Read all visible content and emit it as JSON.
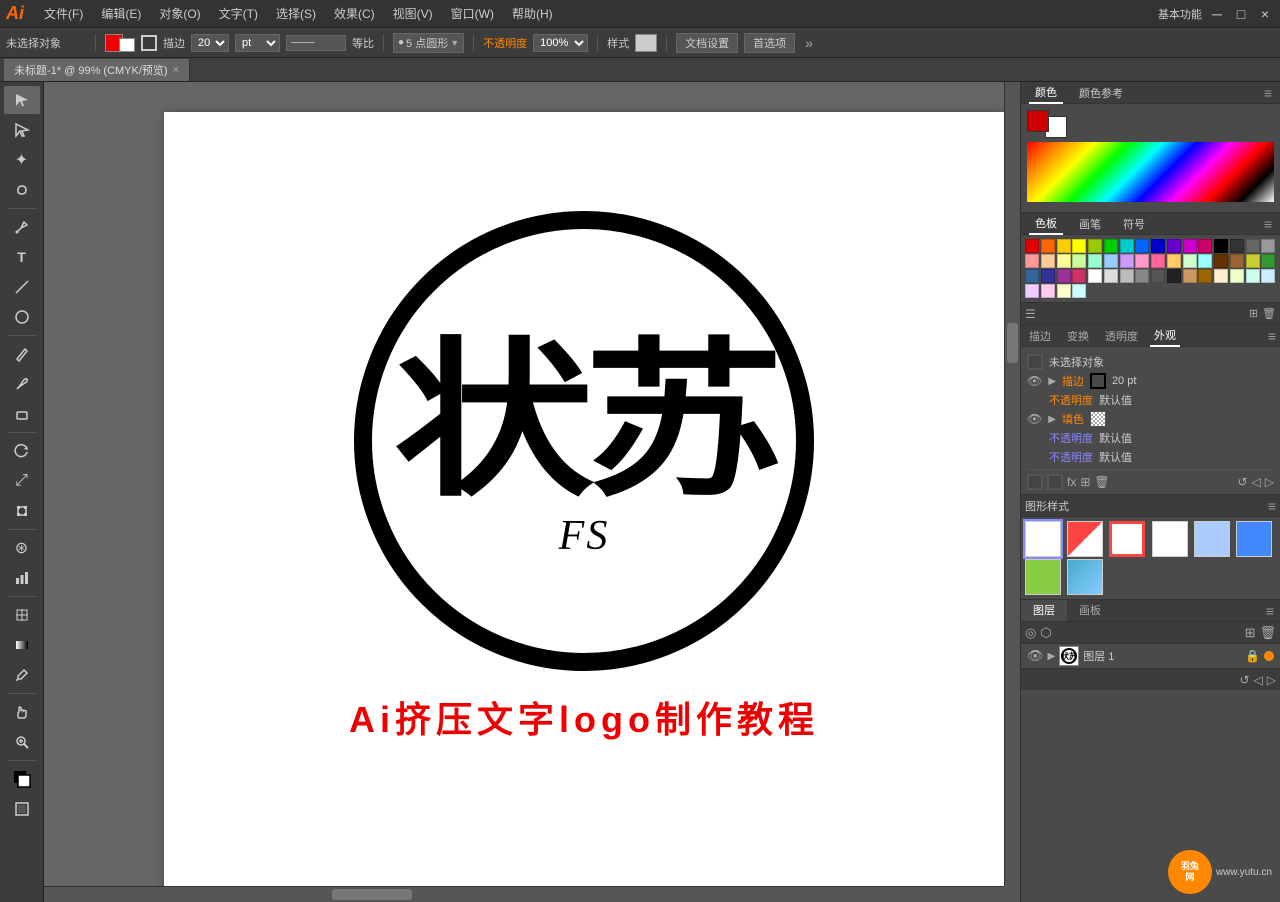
{
  "app": {
    "logo": "Ai",
    "title": "未标题-1",
    "workspace": "基本功能"
  },
  "menu": {
    "items": [
      "文件(F)",
      "编辑(E)",
      "对象(O)",
      "文字(T)",
      "选择(S)",
      "效果(C)",
      "视图(V)",
      "窗口(W)",
      "帮助(H)"
    ]
  },
  "options_bar": {
    "no_selection": "未选择对象",
    "stroke_label": "描边",
    "stroke_width": "20",
    "stroke_unit": "pt",
    "ratio_label": "等比",
    "points_label": "5 点圆形",
    "opacity_label": "不透明度",
    "opacity_value": "100%",
    "style_label": "样式",
    "doc_settings": "文档设置",
    "preferences": "首选项"
  },
  "tab": {
    "label": "未标题-1* @ 99% (CMYK/预览)",
    "close": "×"
  },
  "tools": [
    {
      "name": "selection-tool",
      "icon": "↖",
      "active": true
    },
    {
      "name": "direct-selection-tool",
      "icon": "↗"
    },
    {
      "name": "magic-wand-tool",
      "icon": "✦"
    },
    {
      "name": "lasso-tool",
      "icon": "⌖"
    },
    {
      "name": "pen-tool",
      "icon": "✒"
    },
    {
      "name": "type-tool",
      "icon": "T"
    },
    {
      "name": "line-tool",
      "icon": "／"
    },
    {
      "name": "ellipse-tool",
      "icon": "○"
    },
    {
      "name": "pencil-tool",
      "icon": "✏"
    },
    {
      "name": "paintbrush-tool",
      "icon": "🖌"
    },
    {
      "name": "blob-brush-tool",
      "icon": "◉"
    },
    {
      "name": "eraser-tool",
      "icon": "◻"
    },
    {
      "name": "rotate-tool",
      "icon": "↻"
    },
    {
      "name": "scale-tool",
      "icon": "⤢"
    },
    {
      "name": "free-transform-tool",
      "icon": "⊞"
    },
    {
      "name": "symbol-sprayer-tool",
      "icon": "⊛"
    },
    {
      "name": "column-graph-tool",
      "icon": "▊"
    },
    {
      "name": "mesh-tool",
      "icon": "⊞"
    },
    {
      "name": "gradient-tool",
      "icon": "■"
    },
    {
      "name": "eyedropper-tool",
      "icon": "🔍"
    },
    {
      "name": "blend-tool",
      "icon": "⋈"
    },
    {
      "name": "hand-tool",
      "icon": "✋"
    },
    {
      "name": "zoom-tool",
      "icon": "🔍"
    },
    {
      "name": "fill-stroke",
      "icon": "◧"
    }
  ],
  "right_panel": {
    "color_tab": "颜色",
    "color_ref_tab": "颜色参考",
    "swatches_tab": "色板",
    "brushes_tab": "画笔",
    "symbols_tab": "符号",
    "stroke_tab": "描边",
    "transform_tab": "变换",
    "transparency_tab": "透明度",
    "appearance_tab": "外观"
  },
  "appearance": {
    "section_label": "未选择对象",
    "stroke_label": "描边",
    "stroke_width": "20 pt",
    "fill_label": "填色",
    "opacity_label": "不透明度",
    "opacity_value": "默认值",
    "opacity_label2": "不透明度",
    "opacity_value2": "默认值",
    "opacity_label3": "不透明度",
    "opacity_value3": "默认值"
  },
  "graphic_styles": {
    "panel_label": "图形样式"
  },
  "layers": {
    "tab_label": "图层",
    "panel_tab2": "画板",
    "layer_name": "图层 1"
  },
  "canvas": {
    "logo_chars": "状苏",
    "logo_sub": "FS",
    "tutorial_text": "Ai挤压文字logo制作教程"
  },
  "swatches": {
    "colors": [
      "#e00000",
      "#ff6600",
      "#ffcc00",
      "#ffff00",
      "#99cc00",
      "#00cc00",
      "#00cccc",
      "#0066ff",
      "#0000cc",
      "#6600cc",
      "#cc00cc",
      "#cc0066",
      "#000000",
      "#333333",
      "#666666",
      "#999999",
      "#ff9999",
      "#ffcc99",
      "#ffff99",
      "#ccff99",
      "#99ffcc",
      "#99ccff",
      "#cc99ff",
      "#ff99cc",
      "#ff6699",
      "#ffcc66",
      "#ccffcc",
      "#99ffff",
      "#663300",
      "#996633",
      "#cccc33",
      "#339933",
      "#336699",
      "#333399",
      "#993399",
      "#cc3366",
      "#ffffff",
      "#dddddd",
      "#bbbbbb",
      "#888888",
      "#555555",
      "#222222",
      "#cc9966",
      "#996600",
      "#ffeecc",
      "#eeffcc",
      "#ccffee",
      "#cceeff",
      "#eeccff",
      "#ffccee",
      "#ffffcc",
      "#ccffff"
    ]
  },
  "graphic_style_swatches": [
    {
      "bg": "#ffffff",
      "border": "#ccc"
    },
    {
      "bg": "#ff4444",
      "border": "#ccc"
    },
    {
      "bg": "#ffffff",
      "border": "#f44"
    },
    {
      "bg": "#ffffff",
      "border": "#ccc"
    },
    {
      "bg": "#aaccff",
      "border": "#ccc"
    },
    {
      "bg": "#4488ff",
      "border": "#ccc"
    },
    {
      "bg": "#88cc44",
      "border": "#ccc"
    },
    {
      "bg": "#44aacc",
      "border": "#ccc"
    }
  ],
  "window_controls": {
    "minimize": "─",
    "maximize": "□",
    "close": "×"
  }
}
